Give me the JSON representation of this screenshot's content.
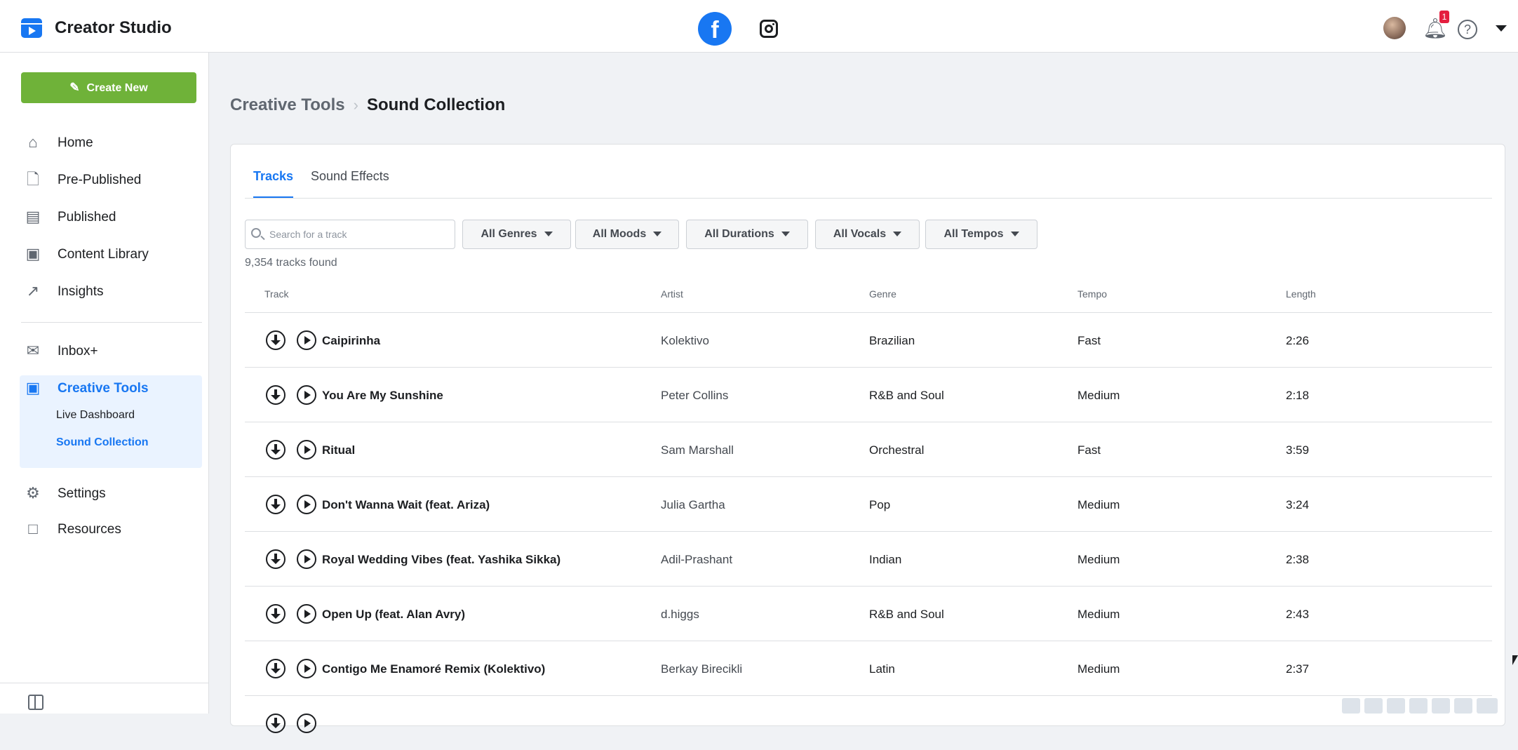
{
  "app": {
    "title": "Creator Studio"
  },
  "platforms": {
    "facebook_glyph": "f"
  },
  "header": {
    "notification_count": "1",
    "help_glyph": "?"
  },
  "sidebar": {
    "create_label": "Create New",
    "items": [
      {
        "label": "Home",
        "icon": "home-icon"
      },
      {
        "label": "Pre-Published",
        "icon": "document-icon"
      },
      {
        "label": "Published",
        "icon": "published-icon"
      },
      {
        "label": "Content Library",
        "icon": "library-icon"
      },
      {
        "label": "Insights",
        "icon": "insights-icon"
      },
      {
        "label": "Inbox+",
        "icon": "inbox-icon"
      },
      {
        "label": "Creative Tools",
        "icon": "creative-tools-icon"
      },
      {
        "label": "Settings",
        "icon": "gear-icon"
      },
      {
        "label": "Resources",
        "icon": "resources-icon"
      }
    ],
    "sub_items": [
      "Live Dashboard",
      "Sound Collection"
    ]
  },
  "breadcrumb": {
    "parent": "Creative Tools",
    "current": "Sound Collection"
  },
  "tabs": [
    "Tracks",
    "Sound Effects"
  ],
  "search": {
    "placeholder": "Search for a track",
    "value": ""
  },
  "filters": [
    "All Genres",
    "All Moods",
    "All Durations",
    "All Vocals",
    "All Tempos"
  ],
  "result_count": "9,354 tracks found",
  "columns": [
    "Track",
    "Artist",
    "Genre",
    "Tempo",
    "Length"
  ],
  "tracks": [
    {
      "title": "Caipirinha",
      "artist": "Kolektivo",
      "genre": "Brazilian",
      "tempo": "Fast",
      "length": "2:26"
    },
    {
      "title": "You Are My Sunshine",
      "artist": "Peter Collins",
      "genre": "R&B and Soul",
      "tempo": "Medium",
      "length": "2:18"
    },
    {
      "title": "Ritual",
      "artist": "Sam Marshall",
      "genre": "Orchestral",
      "tempo": "Fast",
      "length": "3:59"
    },
    {
      "title": "Don't Wanna Wait (feat. Ariza)",
      "artist": "Julia Gartha",
      "genre": "Pop",
      "tempo": "Medium",
      "length": "3:24"
    },
    {
      "title": "Royal Wedding Vibes (feat. Yashika Sikka)",
      "artist": "Adil-Prashant",
      "genre": "Indian",
      "tempo": "Medium",
      "length": "2:38"
    },
    {
      "title": "Open Up (feat. Alan Avry)",
      "artist": "d.higgs",
      "genre": "R&B and Soul",
      "tempo": "Medium",
      "length": "2:43"
    },
    {
      "title": "Contigo Me Enamoré Remix (Kolektivo)",
      "artist": "Berkay Birecikli",
      "genre": "Latin",
      "tempo": "Medium",
      "length": "2:37"
    }
  ],
  "colors": {
    "accent": "#1877f2",
    "create_button": "#6fb239"
  }
}
